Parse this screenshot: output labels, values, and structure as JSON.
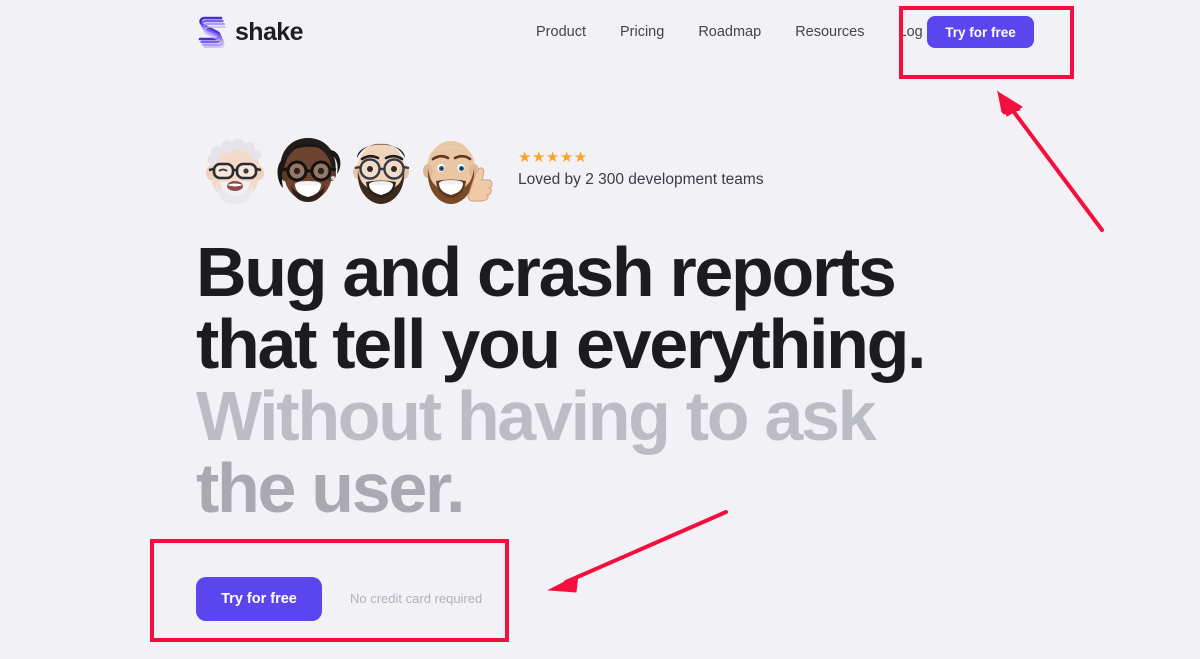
{
  "page": {
    "background_color": "#f2f1f6",
    "accent_color": "#5b46ee",
    "annotation_color": "#f40f3f"
  },
  "header": {
    "logo": {
      "icon": "shake-s-logo-icon",
      "wordmark": "shake"
    },
    "nav_items": [
      {
        "label": "Product"
      },
      {
        "label": "Pricing"
      },
      {
        "label": "Roadmap"
      },
      {
        "label": "Resources"
      },
      {
        "label": "Log in"
      }
    ],
    "cta_button": {
      "label": "Try for free"
    }
  },
  "hero": {
    "avatars": [
      {
        "name": "avatar-older-man-glasses"
      },
      {
        "name": "avatar-woman-glasses"
      },
      {
        "name": "avatar-man-beard-glasses"
      },
      {
        "name": "avatar-bald-man-thumbs-up"
      }
    ],
    "rating": {
      "stars": "★★★★★",
      "star_count": 5,
      "text": "Loved by 2 300 development teams"
    },
    "headline": {
      "line1": "Bug and crash reports",
      "line2": "that tell you everything.",
      "line3": "Without having to ask",
      "line4": "the user."
    },
    "cta": {
      "button_label": "Try for free",
      "note": "No credit card required"
    }
  },
  "annotations": {
    "boxes": [
      {
        "name": "highlight-nav-try-for-free"
      },
      {
        "name": "highlight-hero-cta"
      }
    ],
    "arrows": [
      {
        "name": "arrow-to-nav-cta"
      },
      {
        "name": "arrow-to-hero-cta"
      }
    ]
  }
}
